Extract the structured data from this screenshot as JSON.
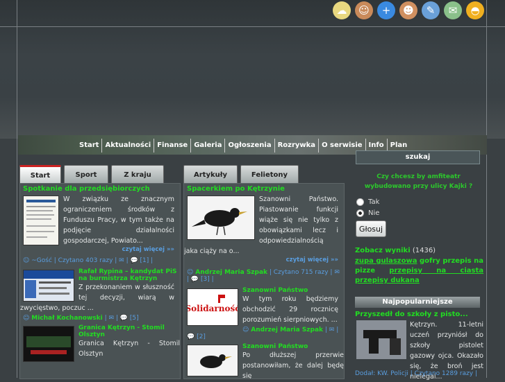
{
  "toolbar": {
    "icons": [
      "weather-icon",
      "user-icon",
      "add-icon",
      "users-icon",
      "write-icon",
      "mail-icon",
      "helmet-icon"
    ]
  },
  "nav": {
    "items": [
      "Start",
      "Aktualności",
      "Finanse",
      "Galeria",
      "Ogłoszenia",
      "Rozrywka",
      "O serwisie",
      "Info",
      "Plan"
    ]
  },
  "search": {
    "label": "szukaj"
  },
  "tabs_left": [
    "Start",
    "Sport",
    "Z kraju"
  ],
  "tabs_mid": [
    "Artykuły",
    "Felietony"
  ],
  "left": {
    "a1": {
      "title": "Spotkanie dla przedsiębiorczych",
      "text": "W związku ze znacznym ograniczeniem środków z Funduszu Pracy, w tym także na podjęcie działalności gospodarczej, Powiato...",
      "more": "czytaj więcej »»",
      "meta": "~Gość | Czytano 403 razy | ",
      "comments": "[1] |"
    },
    "a2": {
      "title": "Rafał Rypina – kandydat PiS na burmistrza Kętrzyn",
      "text": "Z przekonaniem w słuszność tej decyzji, wiarą w zwycięstwo, poczuc ...",
      "author": "Michał Kochanowski",
      "comments": "[5]",
      "thumb_label": "Komitet Powiatowy w Kętrzynie"
    },
    "a3": {
      "title": "Granica Kętrzyn - Stomil Olsztyn",
      "text": "Granica Kętrzyn - Stomil Olsztyn"
    }
  },
  "mid": {
    "a1": {
      "title": "Spacerkiem po Kętrzynie",
      "text": "Szanowni Państwo. Piastowanie funkcji wiąże się nie tylko z obowiązkami lecz i odpowiedzialnością jaka ciąży na o...",
      "more": "czytaj więcej »»",
      "author": "Andrzej Maria Szpak",
      "meta": " | Czytano 715 razy | ",
      "comments": "[3] |"
    },
    "a2": {
      "title": "Szanowni Państwo",
      "text": "W tym roku będziemy obchodzić 29 rocznicę porozumień sierpniowych. ...",
      "author": "Andrzej Maria Szpak",
      "comments": "[2]",
      "thumb_label": "Solidarność"
    },
    "a3": {
      "title": "Szanowni Państwo",
      "text": "Po dłuższej przerwie postanowiłam, że dalej będę się"
    }
  },
  "poll": {
    "question": "Czy chcesz by amfiteatr wybudowano przy ulicy Kajki ?",
    "options": [
      "Tak",
      "Nie"
    ],
    "vote": "Głosuj",
    "results": "Zobacz wyniki",
    "results_count": "(1436)"
  },
  "tags": {
    "items": [
      "zupa gulaszowa",
      "gofry",
      "przepis na pizze",
      "przepisy na ciasta",
      "przepisy dukana"
    ]
  },
  "popular": {
    "header": "Najpopularniejsze",
    "title": "Przyszedł do szkoły z pisto...",
    "text": "Kętrzyn. 11-letni uczeń przyniósł do szkoły pistolet gazowy ojca. Okazało się, że broń jest nielegal...",
    "footer": "Dodał: KW. Policji | Czytano 1289 razy |"
  },
  "colors": {
    "accent_green": "#22dd22",
    "link_blue": "#5a9ee0",
    "tab_red": "#cc2222"
  }
}
